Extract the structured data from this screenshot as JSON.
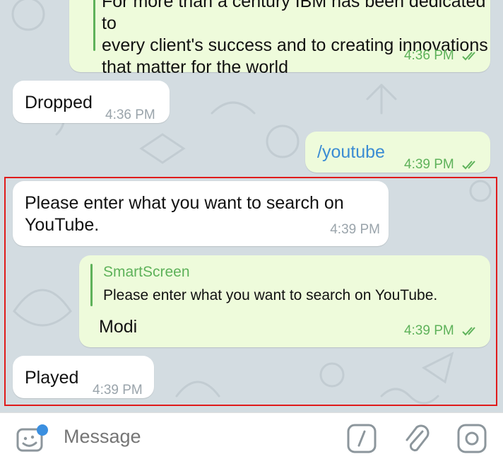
{
  "messages": [
    {
      "id": "m1",
      "direction": "out",
      "lines": [
        "For more than a century IBM has been dedicated to",
        "every client's success and to creating innovations",
        "that matter for the world"
      ],
      "time": "4:36 PM"
    },
    {
      "id": "m2",
      "direction": "in",
      "text": "Dropped",
      "time": "4:36 PM"
    },
    {
      "id": "m3",
      "direction": "out",
      "text": "/youtube",
      "time": "4:39 PM"
    },
    {
      "id": "m4",
      "direction": "in",
      "lines": [
        "Please enter what you want to search on",
        "YouTube."
      ],
      "time": "4:39 PM"
    },
    {
      "id": "m5",
      "direction": "out",
      "reply": {
        "author": "SmartScreen",
        "text": "Please enter what you want to search on YouTube."
      },
      "text": "Modi",
      "time": "4:39 PM"
    },
    {
      "id": "m6",
      "direction": "in",
      "text": "Played",
      "time": "4:39 PM"
    }
  ],
  "composer": {
    "placeholder": "Message",
    "icons": [
      "sticker-icon",
      "bot-command-icon",
      "attach-icon",
      "camera-icon"
    ]
  },
  "colors": {
    "outgoing_bubble": "#eefbdb",
    "incoming_bubble": "#ffffff",
    "accent_green": "#5eb25a",
    "highlight_border": "#e01b1b"
  }
}
